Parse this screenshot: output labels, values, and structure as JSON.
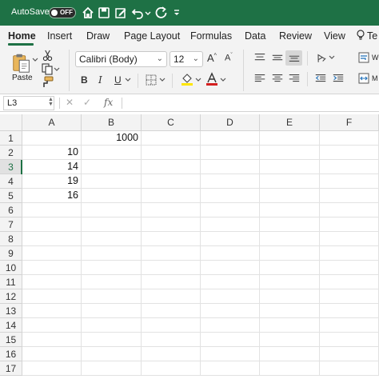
{
  "titlebar": {
    "autosave_label": "AutoSave",
    "autosave_state": "OFF",
    "icons": [
      "home-icon",
      "save-icon",
      "edit-icon",
      "undo-icon",
      "redo-icon",
      "customize-toolbar-icon"
    ]
  },
  "tabs": [
    "Home",
    "Insert",
    "Draw",
    "Page Layout",
    "Formulas",
    "Data",
    "Review",
    "View",
    "Te"
  ],
  "active_tab": "Home",
  "ribbon": {
    "paste_label": "Paste",
    "font_name": "Calibri (Body)",
    "font_size": "12",
    "bold": "B",
    "italic": "I",
    "underline": "U",
    "wrap_label": "W",
    "merge_label": "M"
  },
  "formula_bar": {
    "name_box": "L3",
    "fx_label": "fx",
    "formula": ""
  },
  "grid": {
    "columns": [
      "A",
      "B",
      "C",
      "D",
      "E",
      "F"
    ],
    "rows": [
      "1",
      "2",
      "3",
      "4",
      "5",
      "6",
      "7",
      "8",
      "9",
      "10",
      "11",
      "12",
      "13",
      "14",
      "15",
      "16",
      "17"
    ],
    "selected_row": "3",
    "cells": {
      "B1": "1000",
      "A2": "10",
      "A3": "14",
      "A4": "19",
      "A5": "16"
    }
  },
  "colors": {
    "accent": "#1e7145",
    "font_color_bar": "#d42020",
    "highlight_color_bar": "#ffe600"
  }
}
